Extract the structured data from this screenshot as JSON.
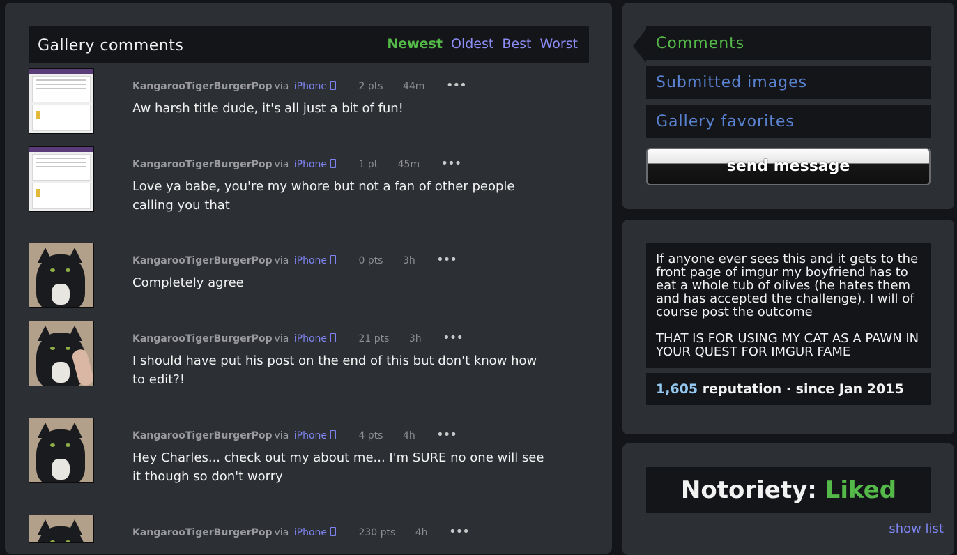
{
  "header": {
    "title": "Gallery comments",
    "sort_tabs": [
      "Newest",
      "Oldest",
      "Best",
      "Worst"
    ],
    "active_sort": "Newest"
  },
  "comments": [
    {
      "author": "KangarooTigerBurgerPop",
      "via": "via",
      "device": "iPhone",
      "points": "2 pts",
      "time": "44m",
      "text": "Aw harsh title dude, it's all just a bit of fun!",
      "thumb": "screenshot"
    },
    {
      "author": "KangarooTigerBurgerPop",
      "via": "via",
      "device": "iPhone",
      "points": "1 pt",
      "time": "45m",
      "text": "Love ya babe, you're my whore but not a fan of other people calling you that",
      "thumb": "screenshot"
    },
    {
      "author": "KangarooTigerBurgerPop",
      "via": "via",
      "device": "iPhone",
      "points": "0 pts",
      "time": "3h",
      "text": "Completely agree",
      "thumb": "cat"
    },
    {
      "author": "KangarooTigerBurgerPop",
      "via": "via",
      "device": "iPhone",
      "points": "21 pts",
      "time": "3h",
      "text": "I should have put his post on the end of this but don't know how to edit?!",
      "thumb": "cat-finger"
    },
    {
      "author": "KangarooTigerBurgerPop",
      "via": "via",
      "device": "iPhone",
      "points": "4 pts",
      "time": "4h",
      "text": "Hey Charles... check out my about me... I'm SURE no one will see it though so don't worry",
      "thumb": "cat"
    },
    {
      "author": "KangarooTigerBurgerPop",
      "via": "via",
      "device": "iPhone",
      "points": "230 pts",
      "time": "4h",
      "text": "",
      "thumb": "cat"
    }
  ],
  "options_glyph": "•••",
  "nav": {
    "items": [
      "Comments",
      "Submitted images",
      "Gallery favorites"
    ],
    "active": "Comments",
    "send_message": "send message"
  },
  "bio": {
    "text": "If anyone ever sees this and it gets to the front page of imgur my boyfriend has to eat a whole tub of olives (he hates them and has accepted the challenge). I will of course post the outcome\n\nTHAT IS FOR USING MY CAT AS A PAWN IN YOUR QUEST FOR IMGUR FAME",
    "reputation": "1,605",
    "reputation_suffix": " reputation · since Jan 2015"
  },
  "notoriety": {
    "label": "Notoriety: ",
    "value": "Liked",
    "show_list": "show list"
  },
  "colors": {
    "accent_green": "#54b948",
    "link_blue": "#7d84f0",
    "nav_blue": "#5a82d2",
    "panel_bg": "#2c2f34",
    "page_bg": "#141518"
  }
}
